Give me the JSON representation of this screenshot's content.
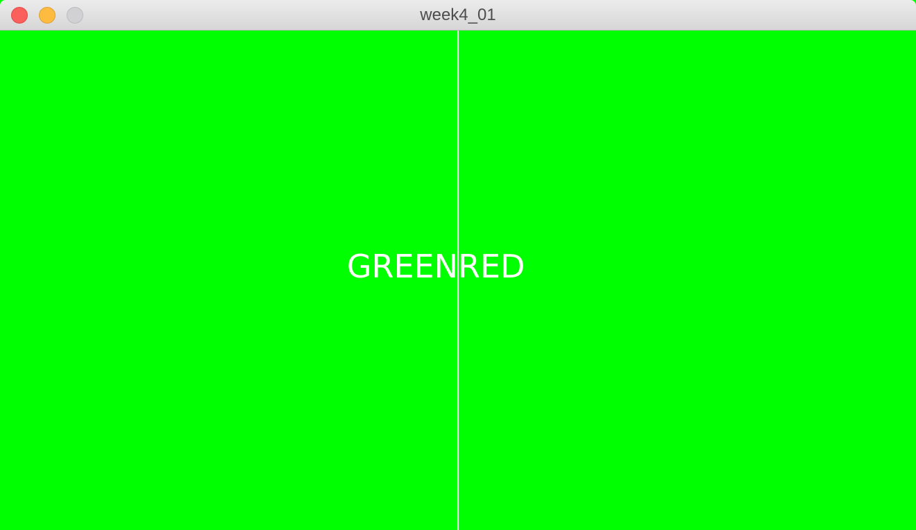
{
  "window": {
    "title": "week4_01"
  },
  "canvas": {
    "background_color": "#00ff00",
    "divider_color": "#ffffff",
    "left_text": "GREEN",
    "right_text": "RED",
    "text_color": "#ffffff"
  }
}
